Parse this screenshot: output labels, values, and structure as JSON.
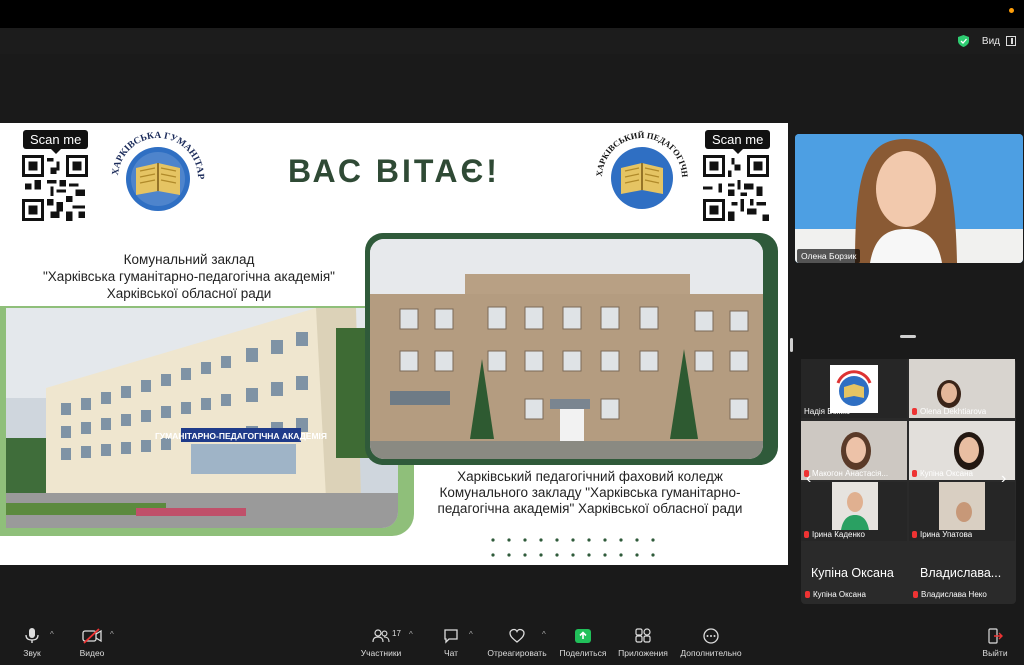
{
  "topbar": {
    "view_label": "Вид"
  },
  "slide": {
    "qr_left_label": "Scan me",
    "qr_right_label": "Scan me",
    "title": "ВАС ВІТАЄ!",
    "academy_lines": [
      "Комунальний заклад",
      "\"Харківська гуманітарно-педагогічна академія\"",
      "Харківської обласної ради"
    ],
    "academy_logo_text": "ХАРКІВСЬКА ГУМАНІТАРНО-ПЕДАГОГІЧНА АКАДЕМІЯ",
    "college_logo_text": "ХАРКІВСЬКИЙ ПЕДАГОГІЧНИЙ ФАХОВИЙ КОЛЕДЖ КЗ «ХГПА»",
    "building_sign": "ГУМАНІТАРНО-ПЕДАГОГІЧНА АКАДЕМІЯ",
    "college_lines": [
      "Харківський педагогічний фаховий коледж",
      "Комунального закладу  \"Харківська гуманітарно-",
      "педагогічна академія\"  Харківської обласної ради"
    ]
  },
  "speaker": {
    "name": "Олена Борзик"
  },
  "gallery": {
    "tiles": [
      {
        "name": "Надія Божко",
        "muted": false
      },
      {
        "name": "Olena Dekhtiarova",
        "muted": true
      },
      {
        "name": "Макогон Анастасія...",
        "muted": true
      },
      {
        "name": "Купіна Оксана",
        "muted": true
      },
      {
        "name": "Ірина Каденко",
        "muted": true
      },
      {
        "name": "Ірина Упатова",
        "muted": true
      }
    ],
    "bottom_big": [
      "Купіна Оксана",
      "Владислава..."
    ],
    "bottom_small": [
      "Купіна Оксана",
      "Владислава Неко"
    ]
  },
  "toolbar": {
    "mic_label": "Звук",
    "video_label": "Видео",
    "participants_label": "Участники",
    "participants_count": "17",
    "chat_label": "Чат",
    "react_label": "Отреагировать",
    "share_label": "Поделиться",
    "apps_label": "Приложения",
    "more_label": "Дополнительно",
    "leave_label": "Выйти"
  },
  "colors": {
    "share_green": "#21c05a",
    "slide_title": "#2f4a35",
    "frame_dark": "#2f5a3a",
    "frame_light": "#8fbf7a"
  }
}
